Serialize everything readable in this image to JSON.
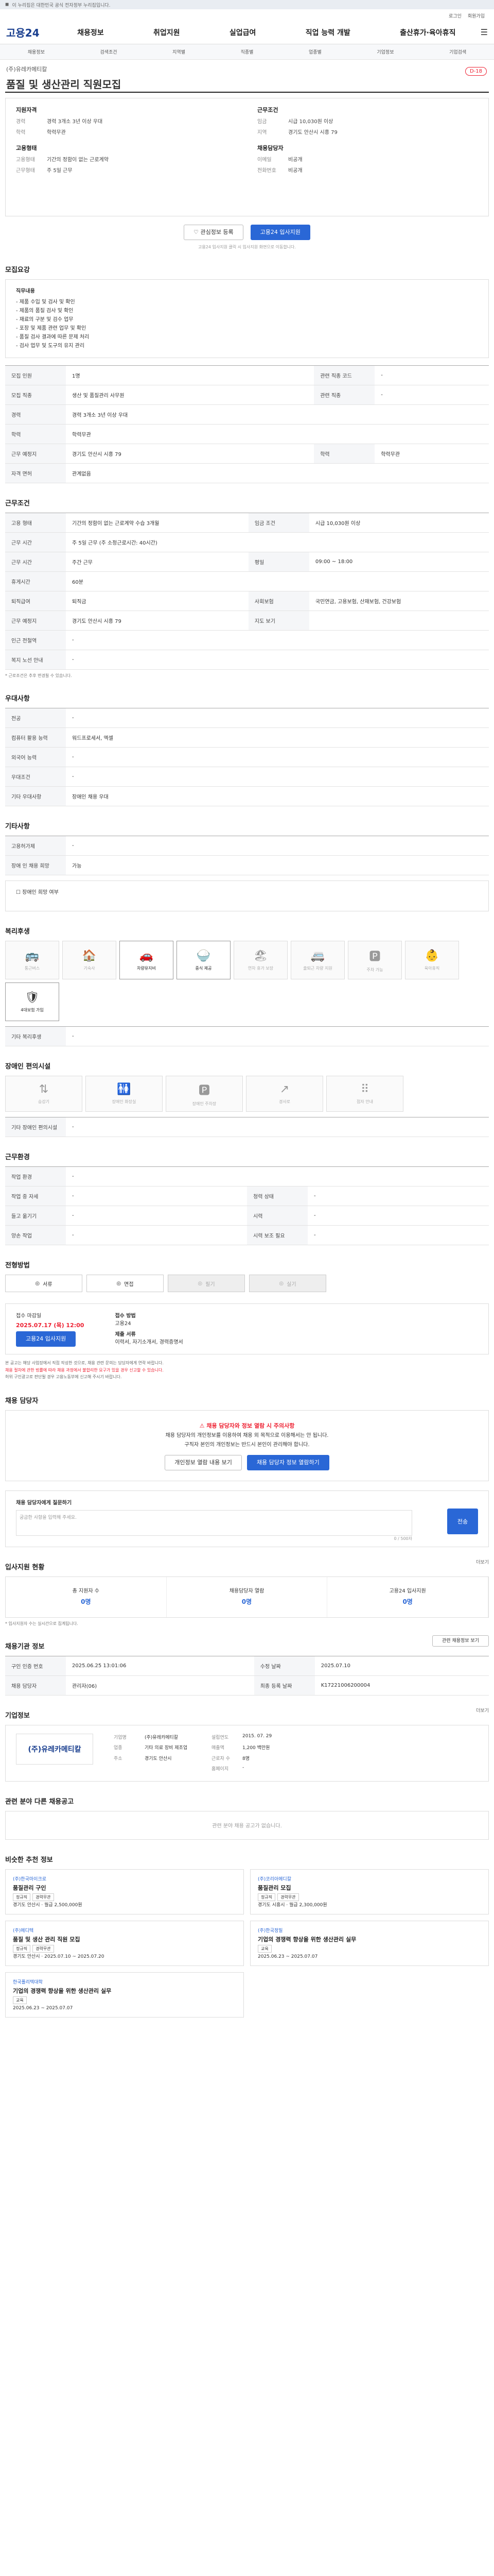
{
  "topbar": {
    "notice": "이 누리집은 대한민국 공식 전자정부 누리집입니다."
  },
  "util": [
    "로그인",
    "회원가입"
  ],
  "gnb": {
    "logo": "고용24",
    "menu": [
      "채용정보",
      "취업지원",
      "실업급여",
      "직업 능력 개발",
      "출산휴가·육아휴직"
    ]
  },
  "subnav": [
    "채용정보",
    "검색조건",
    "지역별",
    "직종별",
    "업종별",
    "기업정보",
    "기업검색"
  ],
  "job": {
    "company": "(주)유레카메티칼",
    "title": "품질 및 생산관리 직원모집",
    "dday": "D-18"
  },
  "summary": {
    "left": {
      "h1": "지원자격",
      "rows1": [
        [
          "경력",
          "경력 3개소 3년 이상 우대"
        ],
        [
          "학력",
          "학력무관"
        ]
      ],
      "h2": "고용형태",
      "rows2": [
        [
          "고용형태",
          "기간의 정함이 없는 근로계약"
        ],
        [
          "근무형태",
          "주 5일 근무"
        ]
      ]
    },
    "right": {
      "h1": "근무조건",
      "rows1": [
        [
          "임금",
          "시급 10,030원 이상"
        ],
        [
          "지역",
          "경기도 안산시 시흥 79"
        ]
      ],
      "h2": "채용담당자",
      "rows2": [
        [
          "이메일",
          "비공개"
        ],
        [
          "전화번호",
          "비공개"
        ]
      ]
    }
  },
  "actions": {
    "save": "관심정보 등록",
    "apply": "고용24 입사지원"
  },
  "actions_note": "고용24 입사지원 클릭 시 입사지원 화면으로 이동합니다.",
  "sec1": {
    "title": "모집요강",
    "heading": "직무내용",
    "lines": [
      "- 제품 수입 및 검사 및 확인",
      "- 제품의 품질 검사 및 확인",
      "- 재료의 구분 및 검수 업무",
      "- 포장 및 제품 관련 업무 및 확인",
      "- 품질 검사 결과에 따른 문제 처리",
      "- 검사 업무 및 도구의 유지 관리"
    ]
  },
  "sec1_table": [
    [
      "모집 인원",
      "1명",
      "관련 직종 코드",
      "-"
    ],
    [
      "모집 직종",
      "생산 및 품질관리 사무원",
      "관련 직종",
      "-"
    ],
    [
      "경력",
      "경력 3개소 3년 이상 우대",
      "",
      ""
    ],
    [
      "학력",
      "학력무관",
      "",
      ""
    ],
    [
      "근무 예정지",
      "경기도 안산시 시흥 79",
      "학력",
      "학력무관"
    ],
    [
      "자격 면허",
      "관계없음",
      "",
      ""
    ]
  ],
  "sec2": {
    "title": "근무조건"
  },
  "sec2_table": [
    [
      "고용 형태",
      "기간의 정함이 없는 근로계약  수습 3개월",
      "임금 조건",
      "시급 10,030원 이상"
    ],
    [
      "근무 시간",
      "주 5일 근무 (주 소정근로시간: 40시간)",
      "",
      ""
    ],
    [
      "근무 시간",
      "주간 근무",
      "평일",
      "09:00 ~ 18:00"
    ],
    [
      "휴게시간",
      "60분",
      "",
      ""
    ],
    [
      "퇴직급여",
      "퇴직금",
      "사회보험",
      "국민연금, 고용보험, 산재보험, 건강보험"
    ],
    [
      "근무 예정지",
      "경기도 안산시 시흥 79",
      "지도 보기",
      ""
    ],
    [
      "인근 전철역",
      "-",
      "",
      ""
    ],
    [
      "복지 노선 안내",
      "-",
      "",
      ""
    ]
  ],
  "sec2_note": "* 근로조건은 추후 변경될 수 있습니다.",
  "sec3": {
    "title": "우대사항",
    "rows": [
      [
        "전공",
        "-"
      ],
      [
        "컴퓨터 활용 능력",
        "워드프로세서, 엑셀"
      ],
      [
        "외국어 능력",
        "-"
      ],
      [
        "우대조건",
        "-"
      ],
      [
        "기타 우대사항",
        "장애인 채용 우대"
      ]
    ]
  },
  "sec4": {
    "title": "기타사항",
    "rows": [
      [
        "고용허가제",
        "-"
      ],
      [
        "장애 인 채용 희망",
        "가능"
      ]
    ],
    "note": "장애인 희망 여부"
  },
  "sec5": {
    "title": "복리후생",
    "items": [
      "통근버스",
      "기숙사",
      "차량유지비",
      "중식 제공",
      "연차 휴가 보장",
      "출퇴근 차량 지원",
      "주차 가능",
      "육아휴직",
      "4대보험 가입"
    ],
    "on": [
      2,
      3,
      8
    ],
    "extra_label": "기타 복리후생",
    "extra": "-"
  },
  "sec6": {
    "title": "장애인 편의시설",
    "items": [
      "승강기",
      "장애인 화장실",
      "장애인 주차장",
      "경사로",
      "점자 안내"
    ],
    "extra_label": "기타 장애인 편의시설",
    "extra": "-"
  },
  "sec7": {
    "title": "근무환경",
    "rows": [
      [
        "작업 환경",
        "-",
        "",
        ""
      ],
      [
        "작업 중 자세",
        "-",
        "청력 상태",
        "-"
      ],
      [
        "들고 옮기기",
        "-",
        "시력",
        "-"
      ],
      [
        "양손 작업",
        "-",
        "시력 보조 필요",
        "-"
      ]
    ]
  },
  "sec8": {
    "title": "전형방법",
    "methods": [
      "서류",
      "면접",
      "필기",
      "실기"
    ],
    "off": [
      2,
      3
    ]
  },
  "sec9": {
    "deadline_label": "접수 마감일",
    "deadline": "2025.07.17 (목) 12:00",
    "method_label": "접수 방법",
    "method": "고용24",
    "docs_label": "제출 서류",
    "docs": "이력서, 자기소개서, 경력증명서",
    "apply": "고용24 입사지원",
    "bullets": [
      "본 공고는 해당 사업장에서 직접 작성한 것으로, 채용 관련 문의는 담당자에게 연락 바랍니다.",
      "채용 절차에 관한 법률에 따라 채용 과정에서 불합리한 요구가 있을 경우 신고할 수 있습니다.",
      "허위 구인광고로 판단될 경우 고용노동부에 신고해 주시기 바랍니다."
    ]
  },
  "sec10": {
    "title": "채용 담당자",
    "warn_title": "채용 담당자와 정보 열람 시 주의사항",
    "warn_lines": [
      "채용 담당자의 개인정보를 이용하여 채용 외 목적으로 이용해서는 안 됩니다.",
      "구직자 본인의 개인정보는 반드시 본인이 관리해야 합니다."
    ],
    "btn1": "개인정보 열람 내용 보기",
    "btn2": "채용 담당자 정보 열람하기"
  },
  "sec11": {
    "title": "채용 담당자에게 질문하기",
    "placeholder": "궁금한 사항을 입력해 주세요.",
    "count": "0 / 500자",
    "send": "전송"
  },
  "sec12": {
    "title": "입사지원 현황",
    "more": "더보기",
    "stats": [
      [
        "총 지원자 수",
        "0명"
      ],
      [
        "채용담당자 열람",
        "0명"
      ],
      [
        "고용24 입사지원",
        "0명"
      ]
    ],
    "note": "* 입사지원자 수는 실시간으로 집계됩니다."
  },
  "sec13": {
    "title": "채용기관 정보",
    "more": "관련 채용정보 보기",
    "rows": [
      [
        "구인 인증 번호",
        "2025.06.25 13:01:06",
        "수정 날짜",
        "2025.07.10"
      ],
      [
        "채용 담당자",
        "관리자(06)",
        "최종 등록 날짜",
        "K17221006200004"
      ]
    ]
  },
  "sec14": {
    "title": "기업정보",
    "more": "더보기",
    "logo": "(주)유레카메티칼",
    "rows": [
      [
        "기업명",
        "(주)유레카메티칼",
        "설립연도",
        "2015. 07. 29"
      ],
      [
        "업종",
        "기타 의료 장비 제조업",
        "매출액",
        "1,200 백만원"
      ],
      [
        "주소",
        "경기도 안산시",
        "근로자 수",
        "8명"
      ],
      [
        "",
        "",
        "홈페이지",
        "-"
      ]
    ]
  },
  "sec15": {
    "title": "관련 분야 다른 채용공고",
    "empty": "관련 분야 채용 공고가 없습니다."
  },
  "sec16": {
    "title": "비슷한 추천 정보",
    "cards": [
      {
        "co": "(주)한국마이크로",
        "title": "품질관리 구인",
        "tags": [
          "정규직",
          "경력무관"
        ],
        "info": "경기도 안산시 · 월급 2,500,000원"
      },
      {
        "co": "(주)코리아메디칼",
        "title": "품질관리 모집",
        "tags": [
          "정규직",
          "경력무관"
        ],
        "info": "경기도 시흥시 · 월급 2,300,000원"
      },
      {
        "co": "(주)메디텍",
        "title": "품질 및 생산 관리 직원 모집",
        "tags": [
          "정규직",
          "경력무관"
        ],
        "info": "경기도 안산시 · 2025.07.10 ~ 2025.07.20"
      },
      {
        "co": "(주)한국정밀",
        "title": "기업의 경쟁력 향상을 위한 생산관리 실무",
        "tags": [
          "교육"
        ],
        "info": "2025.06.23 ~ 2025.07.07"
      },
      {
        "co": "한국폴리텍대학",
        "title": "기업의 경쟁력 향상을 위한 생산관리 실무",
        "tags": [
          "교육"
        ],
        "info": "2025.06.23 ~ 2025.07.07"
      }
    ]
  }
}
